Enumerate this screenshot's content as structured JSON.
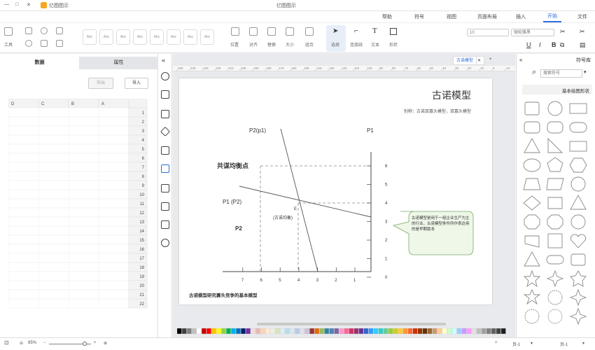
{
  "titlebar": {
    "app_title": "亿图图示",
    "left_label": "亿图图示",
    "window_controls": [
      "minimize",
      "maximize",
      "close"
    ]
  },
  "menubar": {
    "items": [
      "文件",
      "开始",
      "插入",
      "页面布局",
      "视图",
      "符号",
      "帮助"
    ],
    "active": "开始"
  },
  "ribbon": {
    "font_name": "微软雅黑",
    "font_size": "10",
    "group_labels": [
      "工具",
      "选择",
      "连接线",
      "文本",
      "形状"
    ],
    "style_previews": [
      "Abc",
      "Abc",
      "Abc",
      "Abc",
      "Abc",
      "Abc",
      "Abc",
      "Abc",
      "Abc"
    ],
    "extra_labels": [
      "位置",
      "对齐",
      "替换",
      "大小",
      "组合",
      "旋转"
    ]
  },
  "left_panel": {
    "tabs": [
      "数据",
      "属性"
    ],
    "active_tab": "数据",
    "import_label": "导入",
    "export_label": "导出",
    "columns": [
      "A",
      "B",
      "C",
      "D"
    ],
    "rows": [
      "1",
      "2",
      "3",
      "4",
      "5",
      "6",
      "7",
      "8",
      "9",
      "10",
      "11",
      "12",
      "13",
      "14",
      "15",
      "16",
      "17",
      "18",
      "19",
      "20",
      "21",
      "22"
    ]
  },
  "canvas": {
    "doc_tab": "古诺模型",
    "ruler_ticks": [
      "250",
      "240",
      "230",
      "220",
      "210",
      "200",
      "190",
      "180",
      "170",
      "160",
      "150",
      "140",
      "130",
      "120",
      "110",
      "100",
      "90",
      "80",
      "70",
      "60",
      "50",
      "40",
      "30",
      "20",
      "10",
      "0",
      "-10",
      "-20"
    ],
    "page": {
      "title": "古诺模型",
      "subtitle": "别称：古诺双寡头模型，双寡头模型",
      "label_p2p1": "P2(p1)",
      "label_p1": "P1",
      "label_equilibrium": "共谋均衡点",
      "label_p1p2": "P1 (P2)",
      "label_p2": "P2",
      "label_e": "E",
      "label_cournot": "(古诺均衡)",
      "y_ticks": [
        "6",
        "5",
        "4",
        "3",
        "2",
        "1",
        "0"
      ],
      "x_ticks": [
        "1",
        "2",
        "3",
        "4",
        "5",
        "6",
        "7"
      ],
      "callout": "古诺模型是用于一组企业生产为主的行业，古诺模型条件所作表达用的是早期版本",
      "footer": "古诺模型研究寡头竞争的基本模型"
    }
  },
  "palette_colors": [
    "#000000",
    "#404040",
    "#7f7f7f",
    "#bfbfbf",
    "#ffffff",
    "#c00000",
    "#ff0000",
    "#ffc000",
    "#ffff00",
    "#92d050",
    "#00b050",
    "#00b0f0",
    "#0070c0",
    "#002060",
    "#7030a0",
    "#f2dcdb",
    "#e6b9b8",
    "#fcd5b4",
    "#fde9d9",
    "#ebf1de",
    "#d8e4bc",
    "#dbeef3",
    "#b7dee8",
    "#dce6f1",
    "#b8cce4",
    "#e4dfec",
    "#ccc0da",
    "#963634",
    "#e26b0a",
    "#9bbb59",
    "#31869b",
    "#4f81bd",
    "#8064a2",
    "#ff99cc",
    "#ff6699",
    "#cc3366",
    "#993366",
    "#663399",
    "#3366cc",
    "#3399ff",
    "#33ccff",
    "#33cccc",
    "#66cc99",
    "#99cc33",
    "#cccc33",
    "#ffcc33",
    "#ff9933",
    "#ff6633",
    "#cc3300",
    "#993300",
    "#663300",
    "#996633",
    "#cc9966",
    "#ffcc99",
    "#ffffcc",
    "#ccffcc",
    "#ccffff",
    "#99ccff",
    "#cc99ff",
    "#ff99ff",
    "#e0e0e0",
    "#c0c0c0",
    "#a0a0a0",
    "#808080",
    "#606060",
    "#404040",
    "#202020"
  ],
  "right_panel": {
    "title": "符号库",
    "search_placeholder": "搜索符号",
    "category": "基本绘图形状"
  },
  "status": {
    "zoom": "85%",
    "page_label": "页-1",
    "page_label_2": "页-1"
  }
}
